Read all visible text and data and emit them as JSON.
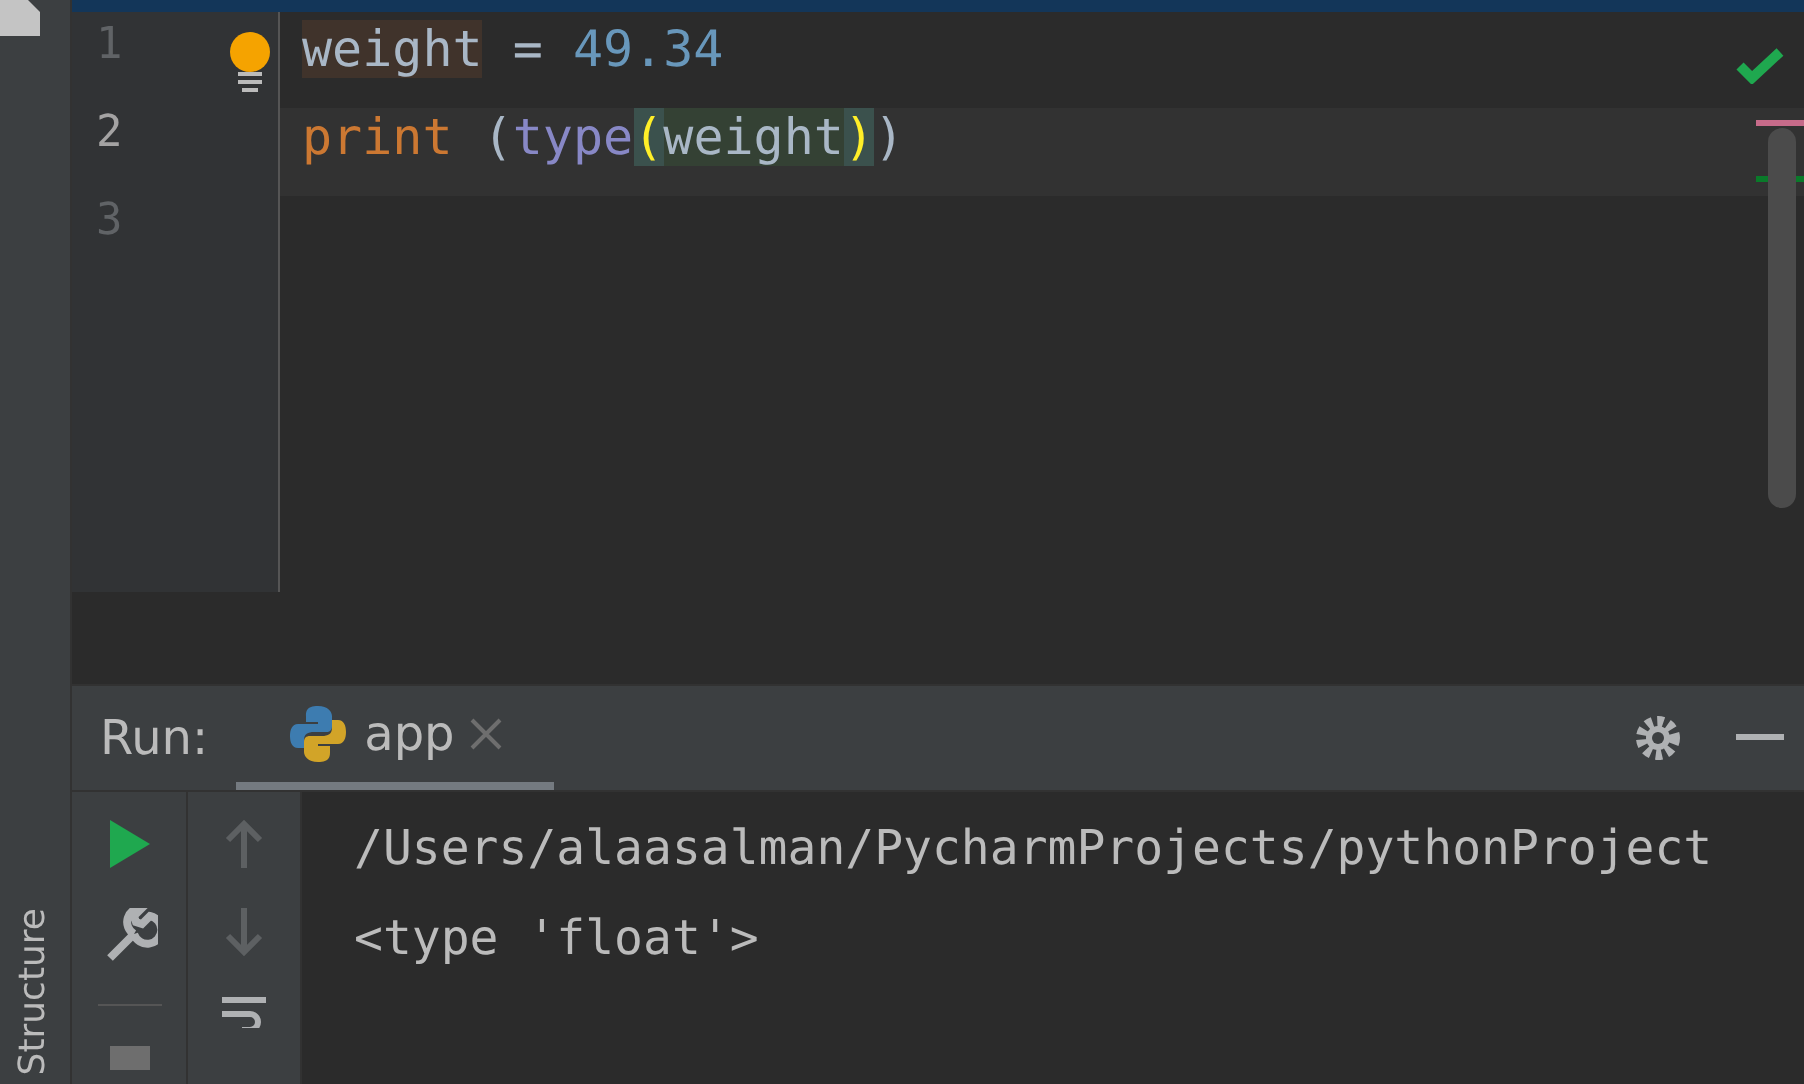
{
  "side_strip": {
    "label": "Structure"
  },
  "editor": {
    "lines": [
      {
        "number": "1",
        "current": false,
        "tokens": [
          {
            "kind": "target",
            "text": "weight",
            "highlighted": true
          },
          {
            "kind": "operator",
            "text": " = ",
            "highlighted": false
          },
          {
            "kind": "number",
            "text": "49.34",
            "highlighted": false
          }
        ]
      },
      {
        "number": "2",
        "current": true,
        "tokens": [
          {
            "kind": "keyword",
            "text": "print",
            "highlighted": false
          },
          {
            "kind": "operator",
            "text": " (",
            "highlighted": false
          },
          {
            "kind": "builtin",
            "text": "type",
            "highlighted": false
          },
          {
            "kind": "brace",
            "text": "(",
            "highlighted": true
          },
          {
            "kind": "identifier",
            "text": "weight",
            "highlighted": true
          },
          {
            "kind": "brace",
            "text": ")",
            "highlighted": true
          },
          {
            "kind": "operator",
            "text": ")",
            "highlighted": false
          }
        ]
      },
      {
        "number": "3",
        "current": false
      }
    ]
  },
  "run_panel": {
    "label": "Run:",
    "tabs": [
      {
        "label": "app",
        "selected": true
      }
    ],
    "console": [
      "/Users/alaasalman/PycharmProjects/pythonProject",
      "<type 'float'>"
    ]
  }
}
